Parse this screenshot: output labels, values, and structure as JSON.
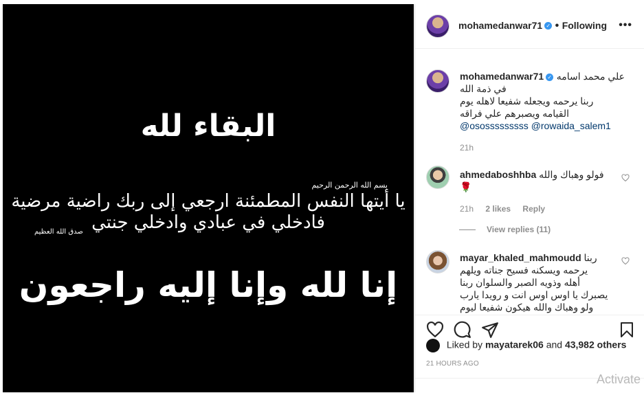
{
  "image": {
    "title": "البقاء لله",
    "basmala": "بسم الله الرحمن الرحيم",
    "verse_line1": "يا أيتها النفس المطمئنة ارجعي إلى ربك راضية مرضية",
    "verse_line2": "فادخلي في عبادي وادخلي جنتي",
    "sadaq": "صدق الله العظيم",
    "inna": "إنا لله وإنا إليه راجعون"
  },
  "header": {
    "username": "mohamedanwar71",
    "separator": "•",
    "follow_status": "Following",
    "more": "•••"
  },
  "caption": {
    "username": "mohamedanwar71",
    "lines": [
      "علي محمد اسامه",
      "في ذمة الله",
      "ربنا يرحمه ويجعله شفيعا لاهله يوم",
      "القيامه ويصبرهم علي فراقه"
    ],
    "mention1": "@ososssssssss",
    "mention2": "@rowaida_salem1",
    "time": "21h"
  },
  "comment1": {
    "username": "ahmedaboshhba",
    "text": "فولو وهباك والله",
    "emoji": "🌹",
    "time": "21h",
    "likes": "2 likes",
    "reply": "Reply",
    "view_replies": "View replies (11)"
  },
  "comment2": {
    "username": "mayar_khaled_mahmoudd",
    "lines": [
      "ربنا",
      "يرحمه ويسكنه فسيح جناته ويلهم",
      "أهله وذويه الصبر والسلوان ربنا",
      "يصبرك يا اوس اوس انت و رويدا يارب",
      "ولو وهباك والله هيكون شفيعا ليوم"
    ]
  },
  "likes": {
    "prefix": "Liked by",
    "user": "mayatarek06",
    "conj": "and",
    "count": "43,982 others"
  },
  "time_ago": "21 HOURS AGO",
  "watermark": "Activate",
  "colors": {
    "verified": "#3897f0",
    "mention": "#00376b",
    "meta": "#8e8e8e"
  },
  "icons": [
    "heart-icon",
    "comment-icon",
    "share-icon",
    "bookmark-icon",
    "verified-badge-icon"
  ]
}
